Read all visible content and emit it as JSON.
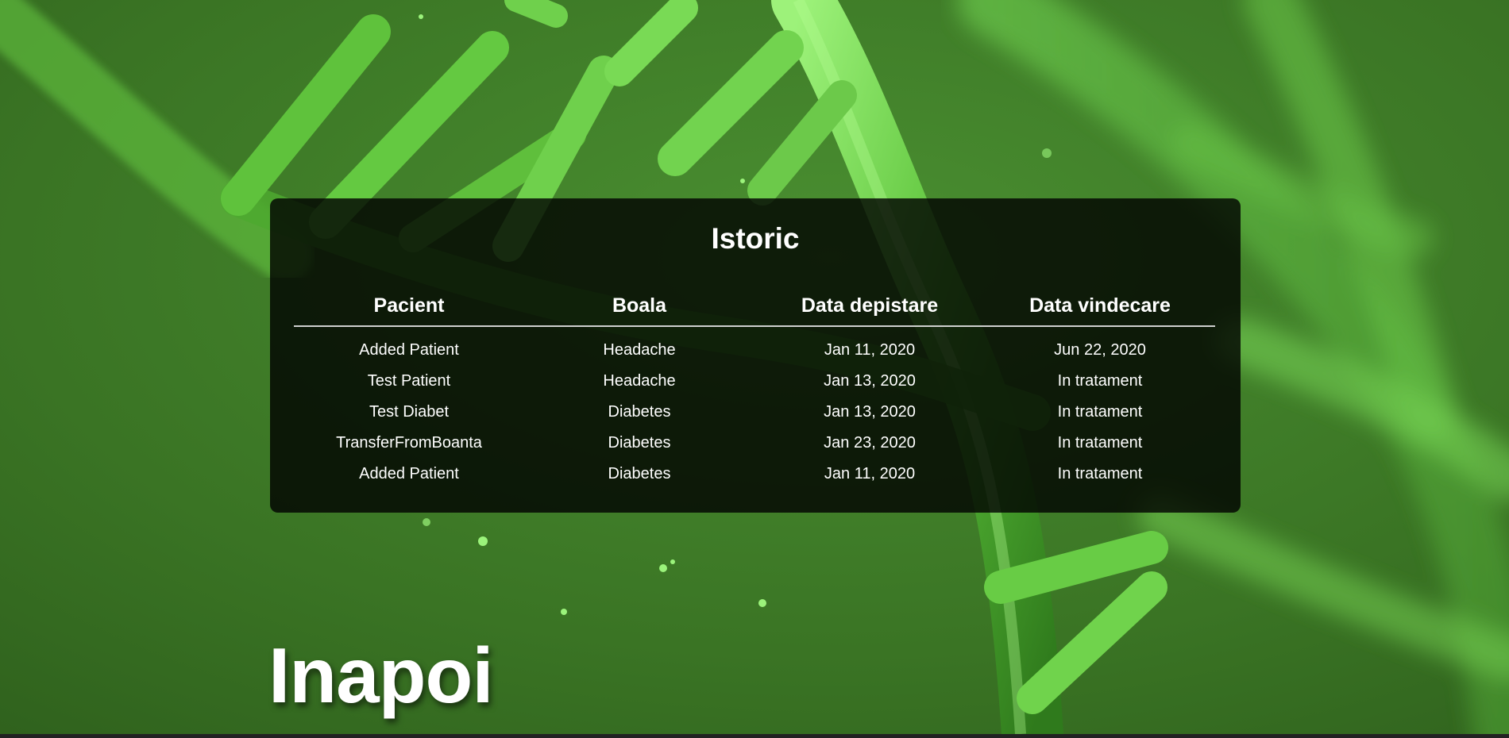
{
  "background": {
    "icon": "dna-helix-image",
    "base_color": "#3d7a28",
    "highlight_color": "#7be35a"
  },
  "history": {
    "title": "Istoric",
    "columns": [
      "Pacient",
      "Boala",
      "Data depistare",
      "Data vindecare"
    ],
    "rows": [
      [
        "Added Patient",
        "Headache",
        "Jan 11, 2020",
        "Jun 22, 2020"
      ],
      [
        "Test Patient",
        "Headache",
        "Jan 13, 2020",
        "In tratament"
      ],
      [
        "Test Diabet",
        "Diabetes",
        "Jan 13, 2020",
        "In tratament"
      ],
      [
        "TransferFromBoanta",
        "Diabetes",
        "Jan 23, 2020",
        "In tratament"
      ],
      [
        "Added Patient",
        "Diabetes",
        "Jan 11, 2020",
        "In tratament"
      ]
    ]
  },
  "nav": {
    "back_label": "Inapoi"
  }
}
